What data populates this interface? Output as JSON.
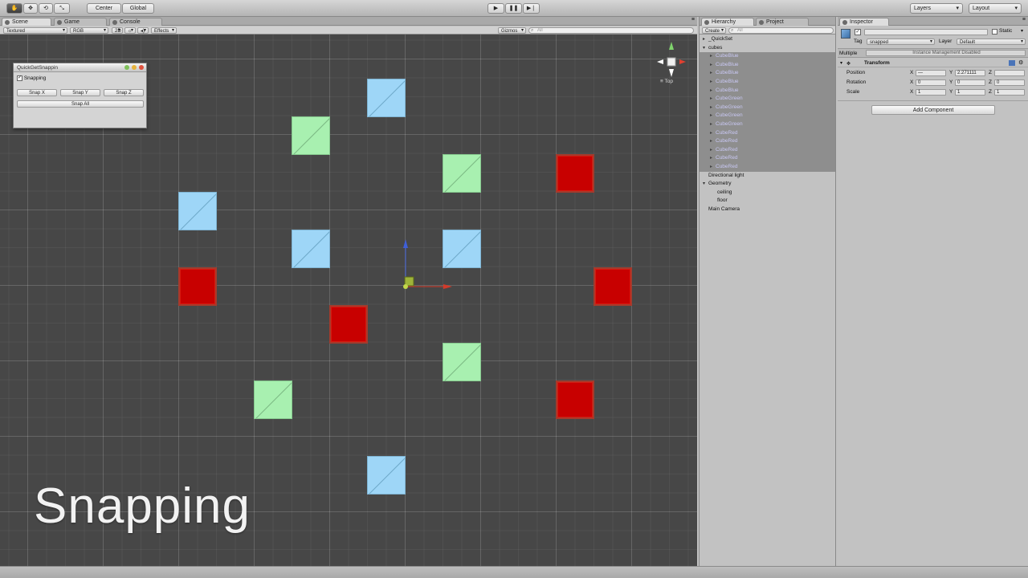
{
  "toolbar": {
    "pivot_label": "Center",
    "space_label": "Global",
    "layers_label": "Layers",
    "layout_label": "Layout"
  },
  "scene_panel": {
    "tabs": [
      "Scene",
      "Game",
      "Console"
    ],
    "shading_mode": "Textured",
    "render_mode": "RGB",
    "toggle_2d": "2D",
    "effects_label": "Effects",
    "gizmos_label": "Gizmos",
    "search_placeholder": "All",
    "view_label": "Top",
    "overlay_title": "Snapping"
  },
  "quick_snap_window": {
    "title": "QuickGetSnappin",
    "checkbox_label": "Snapping",
    "checked": true,
    "snap_x": "Snap X",
    "snap_y": "Snap Y",
    "snap_z": "Snap Z",
    "snap_all": "Snap All"
  },
  "scene_objects": {
    "colors": {
      "blue": "#9ed6f7",
      "green": "#a8f0b0",
      "red": "#c80000",
      "grid": "#474747"
    }
  },
  "hierarchy": {
    "tabs": [
      "Hierarchy",
      "Project"
    ],
    "create_label": "Create",
    "search_placeholder": "All",
    "items": [
      {
        "label": "_QuickSet",
        "depth": 0,
        "arrow": "▸",
        "selected": false
      },
      {
        "label": "cubes",
        "depth": 0,
        "arrow": "▾",
        "selected": false
      },
      {
        "label": "CubeBlue",
        "depth": 1,
        "arrow": "▸",
        "selected": true
      },
      {
        "label": "CubeBlue",
        "depth": 1,
        "arrow": "▸",
        "selected": true
      },
      {
        "label": "CubeBlue",
        "depth": 1,
        "arrow": "▸",
        "selected": true
      },
      {
        "label": "CubeBlue",
        "depth": 1,
        "arrow": "▸",
        "selected": true
      },
      {
        "label": "CubeBlue",
        "depth": 1,
        "arrow": "▸",
        "selected": true
      },
      {
        "label": "CubeGreen",
        "depth": 1,
        "arrow": "▸",
        "selected": true
      },
      {
        "label": "CubeGreen",
        "depth": 1,
        "arrow": "▸",
        "selected": true
      },
      {
        "label": "CubeGreen",
        "depth": 1,
        "arrow": "▸",
        "selected": true
      },
      {
        "label": "CubeGreen",
        "depth": 1,
        "arrow": "▸",
        "selected": true
      },
      {
        "label": "CubeRed",
        "depth": 1,
        "arrow": "▸",
        "selected": true
      },
      {
        "label": "CubeRed",
        "depth": 1,
        "arrow": "▸",
        "selected": true
      },
      {
        "label": "CubeRed",
        "depth": 1,
        "arrow": "▸",
        "selected": true
      },
      {
        "label": "CubeRed",
        "depth": 1,
        "arrow": "▸",
        "selected": true
      },
      {
        "label": "CubeRed",
        "depth": 1,
        "arrow": "▸",
        "selected": true
      },
      {
        "label": "Directional light",
        "depth": 0,
        "arrow": "",
        "selected": false
      },
      {
        "label": "Geometry",
        "depth": 0,
        "arrow": "▾",
        "selected": false
      },
      {
        "label": "ceiling",
        "depth": 2,
        "arrow": "",
        "selected": false
      },
      {
        "label": "floor",
        "depth": 2,
        "arrow": "",
        "selected": false
      },
      {
        "label": "Main Camera",
        "depth": 0,
        "arrow": "",
        "selected": false
      }
    ]
  },
  "inspector": {
    "tab": "Inspector",
    "static_label": "Static",
    "tag_label": "Tag",
    "tag_value": "snapped",
    "layer_label": "Layer",
    "layer_value": "Default",
    "multiple_label": "Multiple",
    "multiple_note": "Instance Management Disabled",
    "transform_label": "Transform",
    "position_label": "Position",
    "rotation_label": "Rotation",
    "scale_label": "Scale",
    "position": {
      "x": "—",
      "y": "2.271111",
      "z": ""
    },
    "rotation": {
      "x": "0",
      "y": "0",
      "z": "0"
    },
    "scale": {
      "x": "1",
      "y": "1",
      "z": "1"
    },
    "axis_x": "X",
    "axis_y": "Y",
    "axis_z": "Z",
    "add_component_label": "Add Component"
  }
}
